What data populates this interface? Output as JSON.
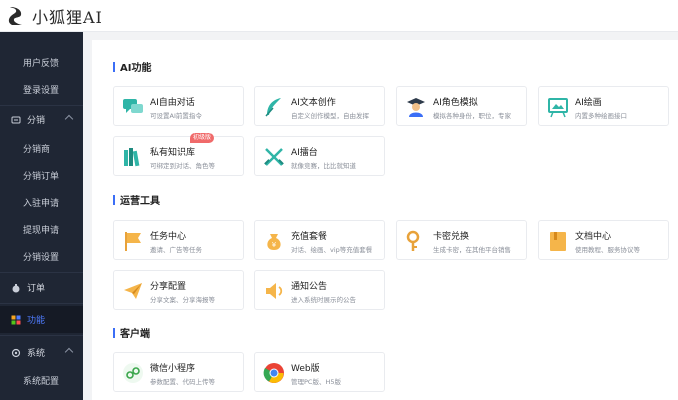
{
  "app": {
    "logo_text": "小狐狸AI"
  },
  "sidebar": {
    "items": [
      {
        "label": "",
        "name": "sidebar-item-partial"
      },
      {
        "label": "用户反馈",
        "name": "sidebar-item-user-feedback"
      },
      {
        "label": "登录设置",
        "name": "sidebar-item-login-settings"
      },
      {
        "label": "分销",
        "name": "sidebar-group-distribution"
      },
      {
        "label": "分销商",
        "name": "sidebar-item-distributors"
      },
      {
        "label": "分销订单",
        "name": "sidebar-item-distribution-orders"
      },
      {
        "label": "入驻申请",
        "name": "sidebar-item-join-applications"
      },
      {
        "label": "提现申请",
        "name": "sidebar-item-withdraw-applications"
      },
      {
        "label": "分销设置",
        "name": "sidebar-item-distribution-settings"
      },
      {
        "label": "订单",
        "name": "sidebar-group-orders"
      },
      {
        "label": "功能",
        "name": "sidebar-group-features"
      },
      {
        "label": "系统",
        "name": "sidebar-group-system"
      },
      {
        "label": "系统配置",
        "name": "sidebar-item-system-config"
      }
    ],
    "colors": {
      "active": "#4f7cff",
      "bg": "#1f2634"
    }
  },
  "sections": {
    "ai": {
      "title": "AI功能"
    },
    "ops": {
      "title": "运营工具"
    },
    "client": {
      "title": "客户端"
    }
  },
  "cards": {
    "ai_chat": {
      "title": "AI自由对话",
      "desc": "可设置AI前置指令"
    },
    "ai_writing": {
      "title": "AI文本创作",
      "desc": "自定义创作模型，自由发挥"
    },
    "ai_role": {
      "title": "AI角色模拟",
      "desc": "模拟各种身份，职位，专家"
    },
    "ai_draw": {
      "title": "AI绘画",
      "desc": "内置多种绘画接口"
    },
    "knowledge": {
      "title": "私有知识库",
      "desc": "可绑定到对话、角色等",
      "badge": "初级版"
    },
    "arena": {
      "title": "AI擂台",
      "desc": "就像竞赛，比比就知道"
    },
    "task": {
      "title": "任务中心",
      "desc": "邀请、广告等任务"
    },
    "recharge": {
      "title": "充值套餐",
      "desc": "对话、绘画、vip等充值套餐"
    },
    "card_redeem": {
      "title": "卡密兑换",
      "desc": "生成卡密，在其他平台销售"
    },
    "docs": {
      "title": "文档中心",
      "desc": "使用教程、服务协议等"
    },
    "share": {
      "title": "分享配置",
      "desc": "分享文案、分享海报等"
    },
    "notice": {
      "title": "通知公告",
      "desc": "进入系统时展示的公告"
    },
    "miniprogram": {
      "title": "微信小程序",
      "desc": "参数配置、代码上传等"
    },
    "web": {
      "title": "Web版",
      "desc": "管理PC版、H5版"
    }
  }
}
